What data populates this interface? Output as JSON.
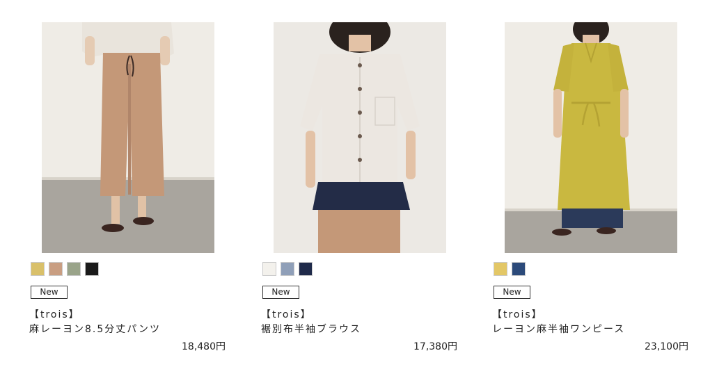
{
  "products": [
    {
      "badge": "New",
      "brand": "【trois】",
      "name": "麻レーヨン8.5分丈パンツ",
      "price": "18,480円",
      "colors": [
        "#d9c06a",
        "#c99e82",
        "#9aa48a",
        "#1a1a1a"
      ]
    },
    {
      "badge": "New",
      "brand": "【trois】",
      "name": "裾別布半袖ブラウス",
      "price": "17,380円",
      "colors": [
        "#f3f1ec",
        "#8f9fb8",
        "#1f2a4a"
      ]
    },
    {
      "badge": "New",
      "brand": "【trois】",
      "name": "レーヨン麻半袖ワンピース",
      "price": "23,100円",
      "colors": [
        "#e3c766",
        "#2c4a7a"
      ]
    }
  ]
}
